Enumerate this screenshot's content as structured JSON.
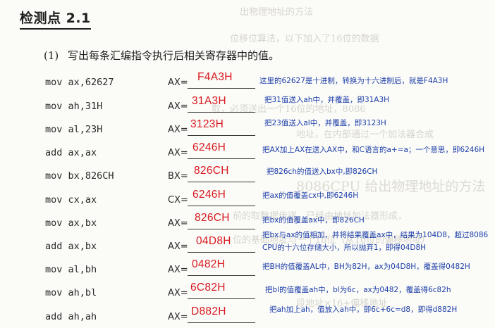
{
  "header": {
    "title": "检测点 2.1"
  },
  "question": {
    "number": "(1)",
    "text": "写出每条汇编指令执行后相关寄存器中的值。"
  },
  "background_text": [
    "出物理地址的方法",
    "位移位算法，以下加入了16位的数据",
    "取，必须送出一个16位的地址，8086",
    "地址，在内部通过一个加法器合成",
    "8086CPU 给出物理地址的方法",
    "前的取数据传送，已经由地址加法器形成，",
    "位的基础地址与一个16位（从16位的偏移地址）",
    "段地址×16+偏移地址"
  ],
  "rows": [
    {
      "instr": "mov ax,62627",
      "reg": "AX=",
      "answer": "F4A3H",
      "note": "这里的62627是十进制，转换为十六进制后，就是F4A3H"
    },
    {
      "instr": "mov ah,31H",
      "reg": "AX=",
      "answer": "31A3H",
      "note": "把31值送入ah中，并覆盖，即31A3H"
    },
    {
      "instr": "mov al,23H",
      "reg": "AX=",
      "answer": "3123H",
      "note": "把23值送入al中，并覆盖，即3123H"
    },
    {
      "instr": "add ax,ax",
      "reg": "AX=",
      "answer": "6246H",
      "note": "把AX加上AX在送入AX中，和C语言的a+=a；一个意思，即6246H"
    },
    {
      "instr": "mov bx,826CH",
      "reg": "BX=",
      "answer": "826CH",
      "note": "把826ch的值送入bx中,即826CH"
    },
    {
      "instr": "mov cx,ax",
      "reg": "CX=",
      "answer": "6246H",
      "note": "把ax的值覆盖cx中,即6246H"
    },
    {
      "instr": "mov ax,bx",
      "reg": "AX=",
      "answer": "826CH",
      "note": "把bx的值覆盖ax中，即826CH"
    },
    {
      "instr": "add ax,bx",
      "reg": "AX=",
      "answer": "04D8H",
      "note": "把bx与ax的值相加，并将结果覆盖ax中，结果为104D8，超过8086",
      "note2": "CPU的十六位存储大小，所以抛弃1，即得04D8H"
    },
    {
      "instr": "mov al,bh",
      "reg": "AX=",
      "answer": "0482H",
      "note": "把BH的值覆盖AL中，BH为82H，ax为04D8H，覆盖得0482H"
    },
    {
      "instr": "mov ah,bl",
      "reg": "AX=",
      "answer": "6C82H",
      "note": "把bl的值覆盖ah中，bl为6c，ax为0482，覆盖得6c82h"
    },
    {
      "instr": "add ah,ah",
      "reg": "AX=",
      "answer": "D882H",
      "note": "把ah加上ah，值放入ah中，即6c+6c=d8，即得d882H"
    }
  ]
}
